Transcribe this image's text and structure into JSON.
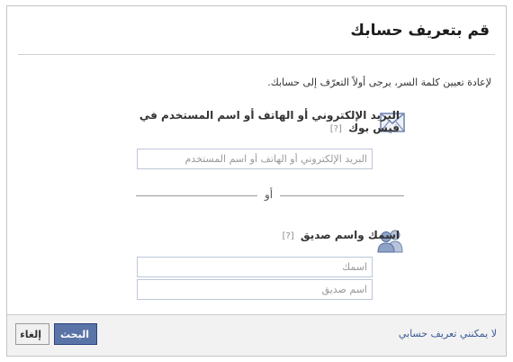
{
  "dialog": {
    "title": "قم بتعريف حسابك",
    "instruction": "لإعادة تعيين كلمة السر، يرجى أولاً التعرّف إلى حسابك."
  },
  "identify": {
    "label": "البريد الإلكتروني أو الهاتف أو اسم المستخدم في فيس بوك",
    "help": "[?]",
    "placeholder": "البريد الإلكتروني أو الهاتف أو اسم المستخدم"
  },
  "separator": {
    "text": "أو"
  },
  "friend": {
    "label": "اسمك واسم صديق",
    "help": "[?]",
    "name_placeholder": "اسمك",
    "friend_placeholder": "اسم صديق"
  },
  "footer": {
    "link": "لا يمكنني تعريف حسابي",
    "search_label": "البحث",
    "cancel_label": "إلغاء"
  },
  "icons": {
    "email": "envelope-icon",
    "friends": "people-icon"
  },
  "colors": {
    "brand_blue": "#5b74a8",
    "link_blue": "#3b5998"
  }
}
